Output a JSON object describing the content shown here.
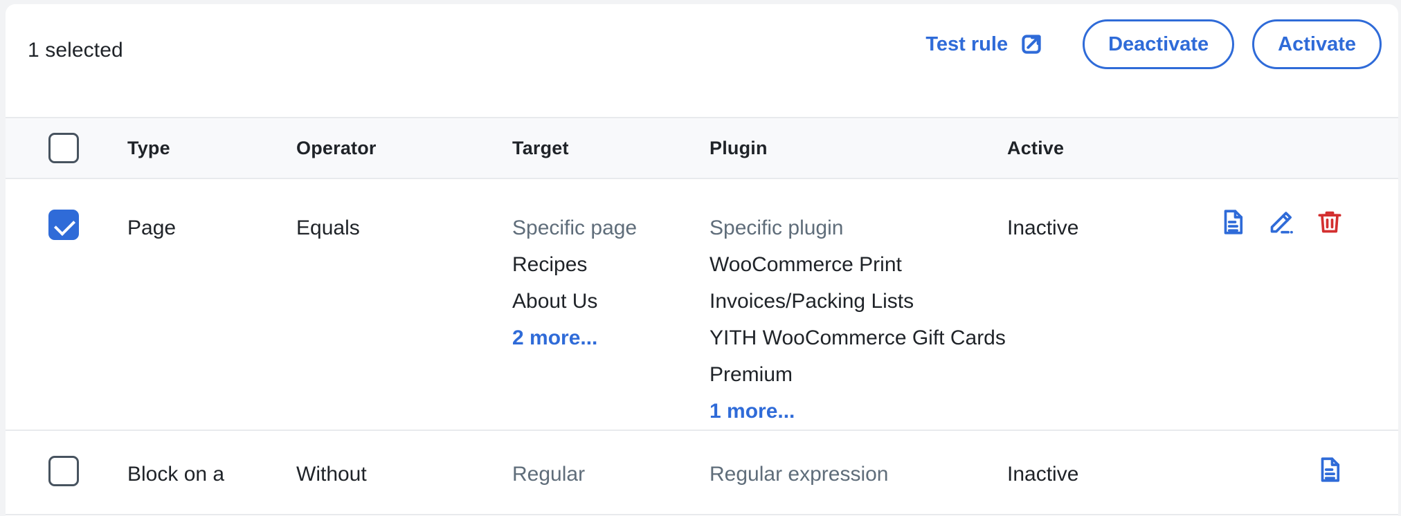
{
  "toolbar": {
    "selected_label": "1 selected",
    "test_rule_label": "Test rule",
    "test_rule_icon": "external-link-icon",
    "deactivate_label": "Deactivate",
    "activate_label": "Activate"
  },
  "colors": {
    "accent_blue": "#2f6bd8",
    "danger_red": "#d32f2f",
    "muted_text": "#5f6d7a",
    "text": "#1f2328",
    "header_bg": "#f8f9fb",
    "border": "#e8eaed"
  },
  "table": {
    "columns": [
      {
        "key": "select",
        "label": ""
      },
      {
        "key": "type",
        "label": "Type"
      },
      {
        "key": "operator",
        "label": "Operator"
      },
      {
        "key": "target",
        "label": "Target"
      },
      {
        "key": "plugin",
        "label": "Plugin"
      },
      {
        "key": "active",
        "label": "Active"
      },
      {
        "key": "actions",
        "label": ""
      }
    ],
    "rows": [
      {
        "selected": true,
        "type": "Page",
        "operator": "Equals",
        "target": {
          "kind": "Specific page",
          "values": [
            "Recipes",
            "About Us"
          ],
          "more": "2 more..."
        },
        "plugin": {
          "kind": "Specific plugin",
          "values": [
            "WooCommerce Print Invoices/Packing Lists",
            "YITH WooCommerce Gift Cards Premium"
          ],
          "more": "1 more..."
        },
        "active": "Inactive",
        "actions": [
          "document-icon",
          "edit-pencil-icon",
          "trash-delete-icon"
        ]
      },
      {
        "selected": false,
        "type": "Block on a",
        "operator": "Without",
        "target": {
          "kind": "Regular",
          "values": [],
          "more": ""
        },
        "plugin": {
          "kind": "Regular expression",
          "values": [],
          "more": ""
        },
        "active": "Inactive",
        "actions": [
          "document-icon"
        ]
      }
    ]
  }
}
